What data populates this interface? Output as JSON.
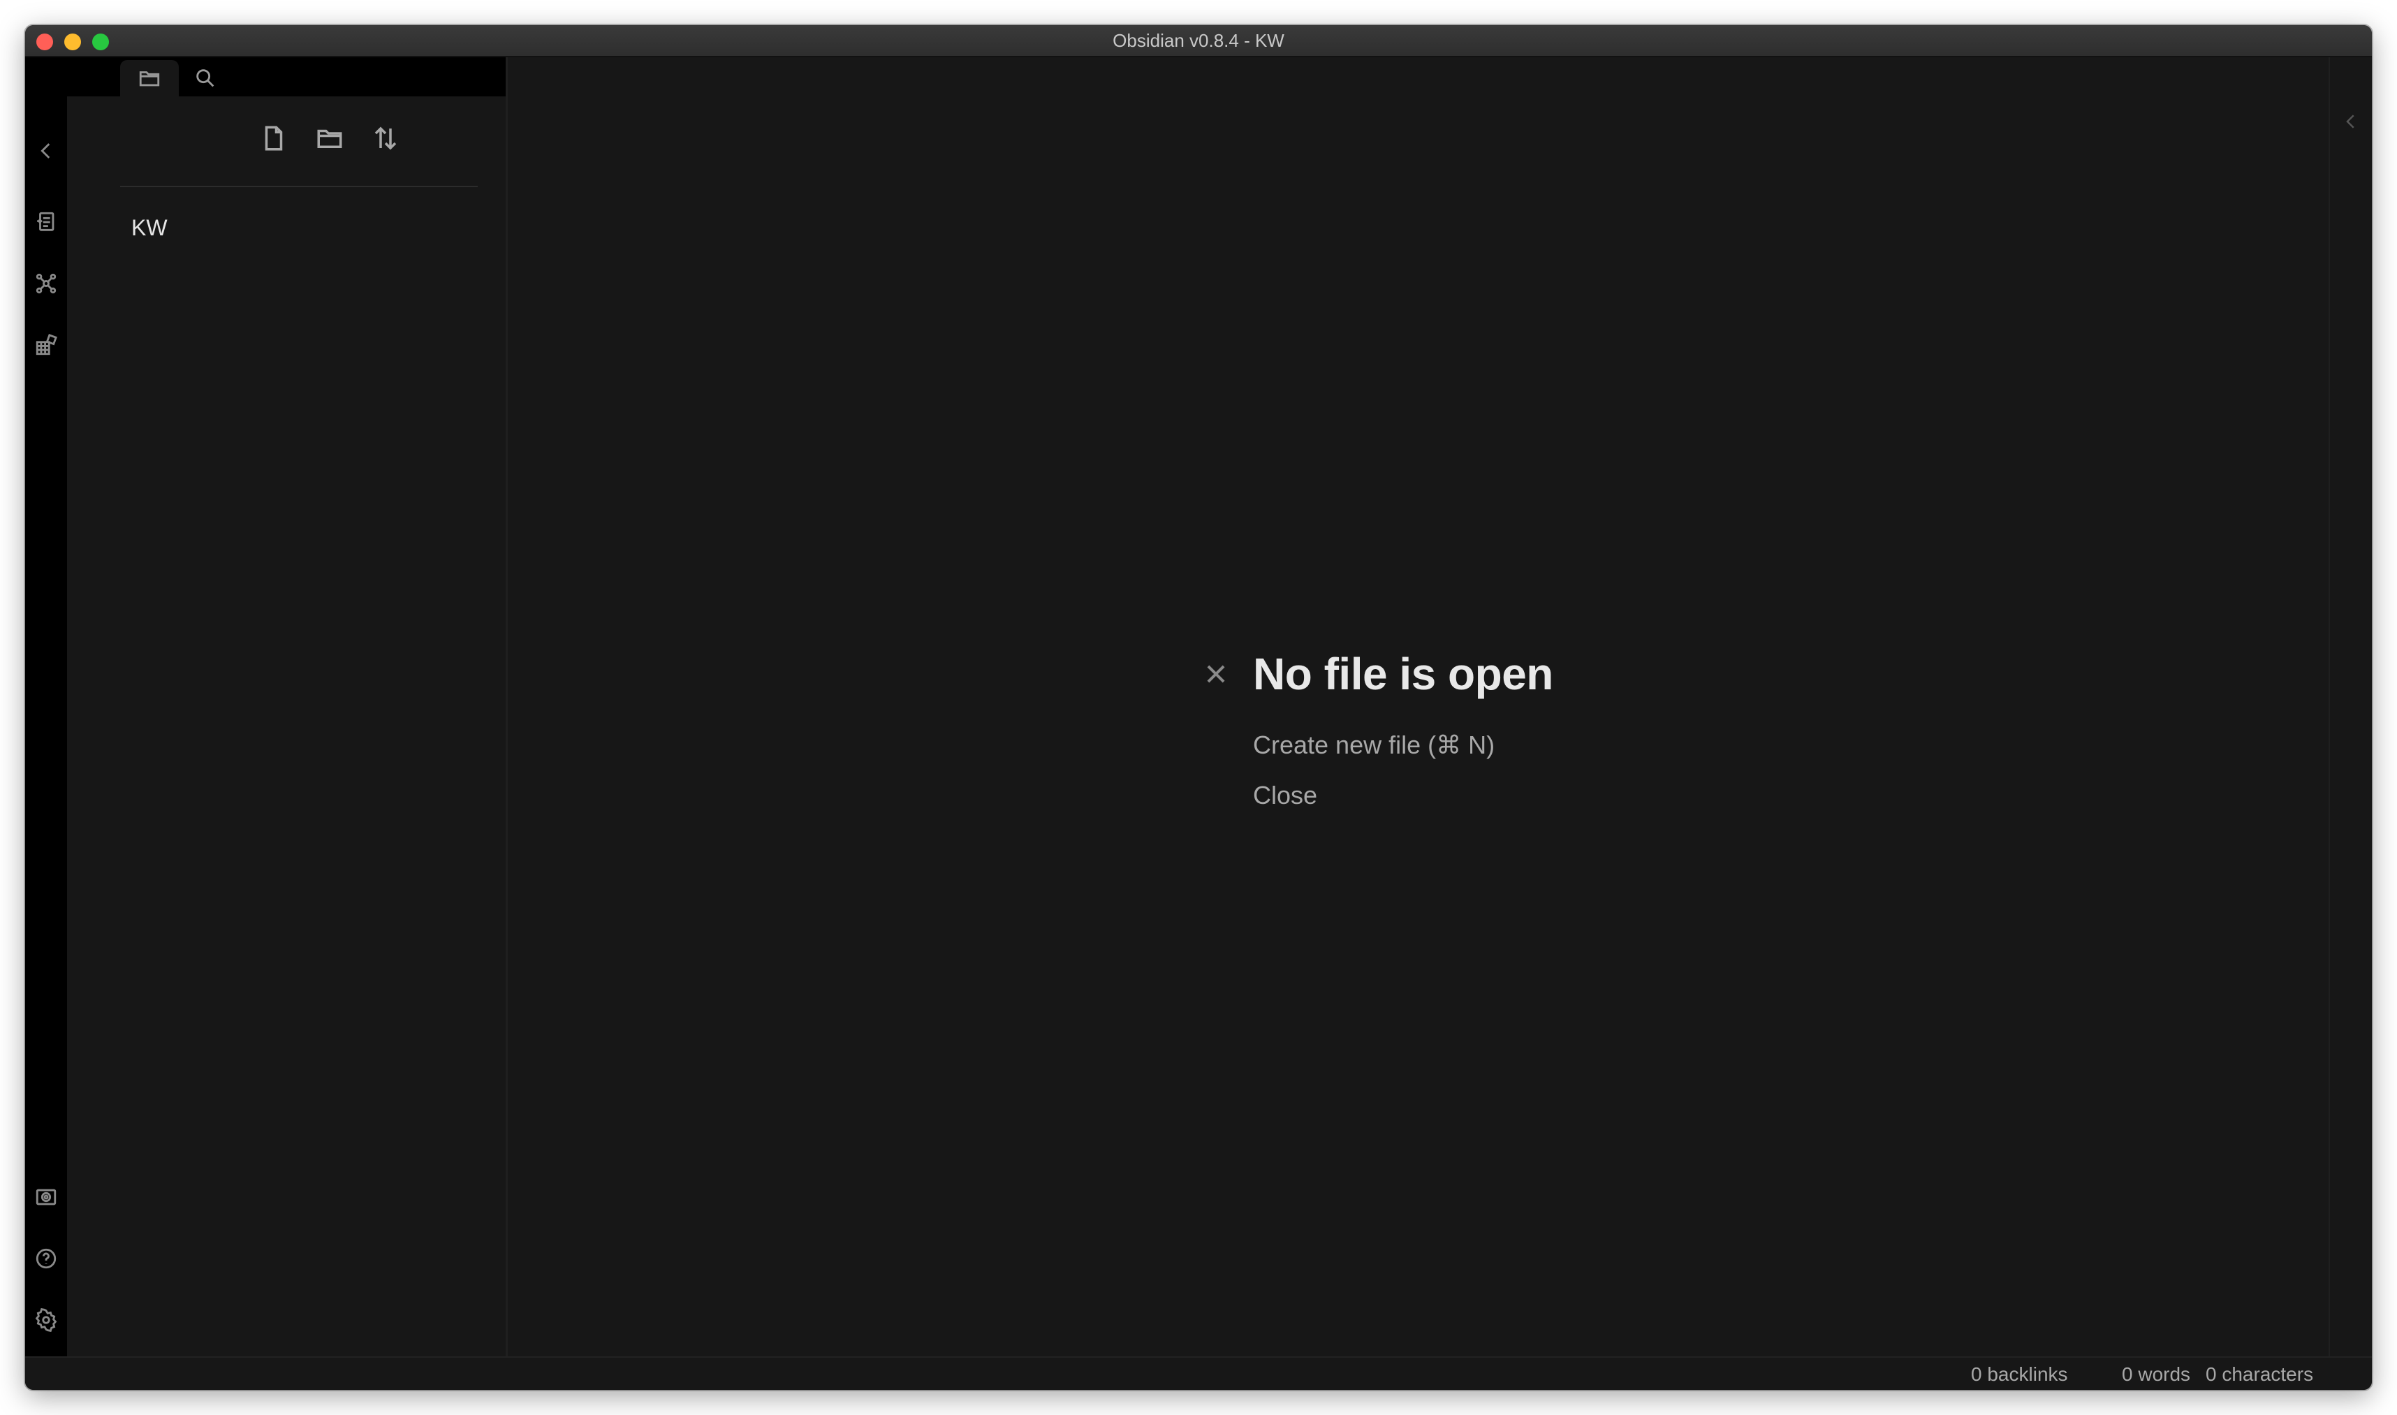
{
  "window": {
    "title": "Obsidian v0.8.4 - KW"
  },
  "ribbon": {
    "icons": [
      "chevron-left-icon",
      "document-switcher-icon",
      "graph-view-icon",
      "starter-kit-icon",
      "vault-icon",
      "help-icon",
      "settings-icon"
    ]
  },
  "sidebar": {
    "tabs": [
      "folder-icon",
      "search-icon"
    ],
    "actions": [
      "new-note-icon",
      "new-folder-icon",
      "sort-icon"
    ],
    "vault_name": "KW"
  },
  "main": {
    "empty_state": {
      "title": "No file is open",
      "create_label": "Create new file (⌘ N)",
      "close_label": "Close"
    }
  },
  "statusbar": {
    "backlinks": "0 backlinks",
    "words": "0 words",
    "characters": "0 characters"
  },
  "colors": {
    "background": "#171717",
    "ribbon": "#000000",
    "text_primary": "#e8e8e8",
    "text_muted": "#a8a8a8"
  }
}
